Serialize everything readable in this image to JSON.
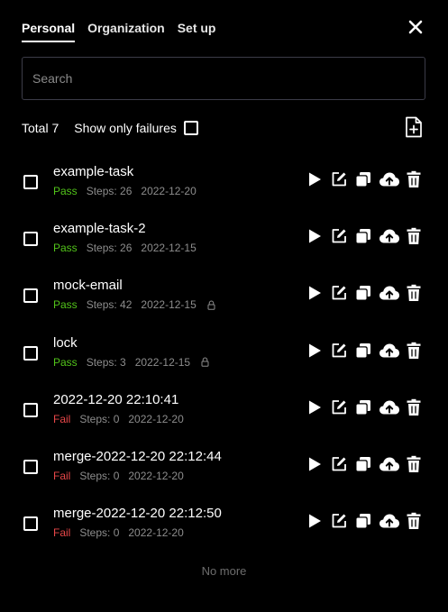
{
  "tabs": [
    {
      "label": "Personal",
      "active": true
    },
    {
      "label": "Organization",
      "active": false
    },
    {
      "label": "Set up",
      "active": false
    }
  ],
  "search": {
    "placeholder": "Search",
    "value": ""
  },
  "summary": {
    "total_label": "Total 7",
    "filter_label": "Show only failures",
    "filter_checked": false
  },
  "tasks": [
    {
      "name": "example-task",
      "status": "Pass",
      "steps": "Steps: 26",
      "date": "2022-12-20",
      "locked": false
    },
    {
      "name": "example-task-2",
      "status": "Pass",
      "steps": "Steps: 26",
      "date": "2022-12-15",
      "locked": false
    },
    {
      "name": "mock-email",
      "status": "Pass",
      "steps": "Steps: 42",
      "date": "2022-12-15",
      "locked": true
    },
    {
      "name": "lock",
      "status": "Pass",
      "steps": "Steps: 3",
      "date": "2022-12-15",
      "locked": true
    },
    {
      "name": "2022-12-20 22:10:41",
      "status": "Fail",
      "steps": "Steps: 0",
      "date": "2022-12-20",
      "locked": false
    },
    {
      "name": "merge-2022-12-20 22:12:44",
      "status": "Fail",
      "steps": "Steps: 0",
      "date": "2022-12-20",
      "locked": false
    },
    {
      "name": "merge-2022-12-20 22:12:50",
      "status": "Fail",
      "steps": "Steps: 0",
      "date": "2022-12-20",
      "locked": false
    }
  ],
  "footer": {
    "no_more": "No more"
  },
  "colors": {
    "background": "#000000",
    "pass": "#52c41a",
    "fail": "#e84749",
    "muted": "#8d8d8d"
  },
  "icons": {
    "close": "close-icon",
    "new_file": "file-plus-icon",
    "run": "play-icon",
    "edit": "edit-icon",
    "copy": "copy-icon",
    "upload": "cloud-upload-icon",
    "delete": "trash-icon",
    "lock": "lock-icon"
  }
}
